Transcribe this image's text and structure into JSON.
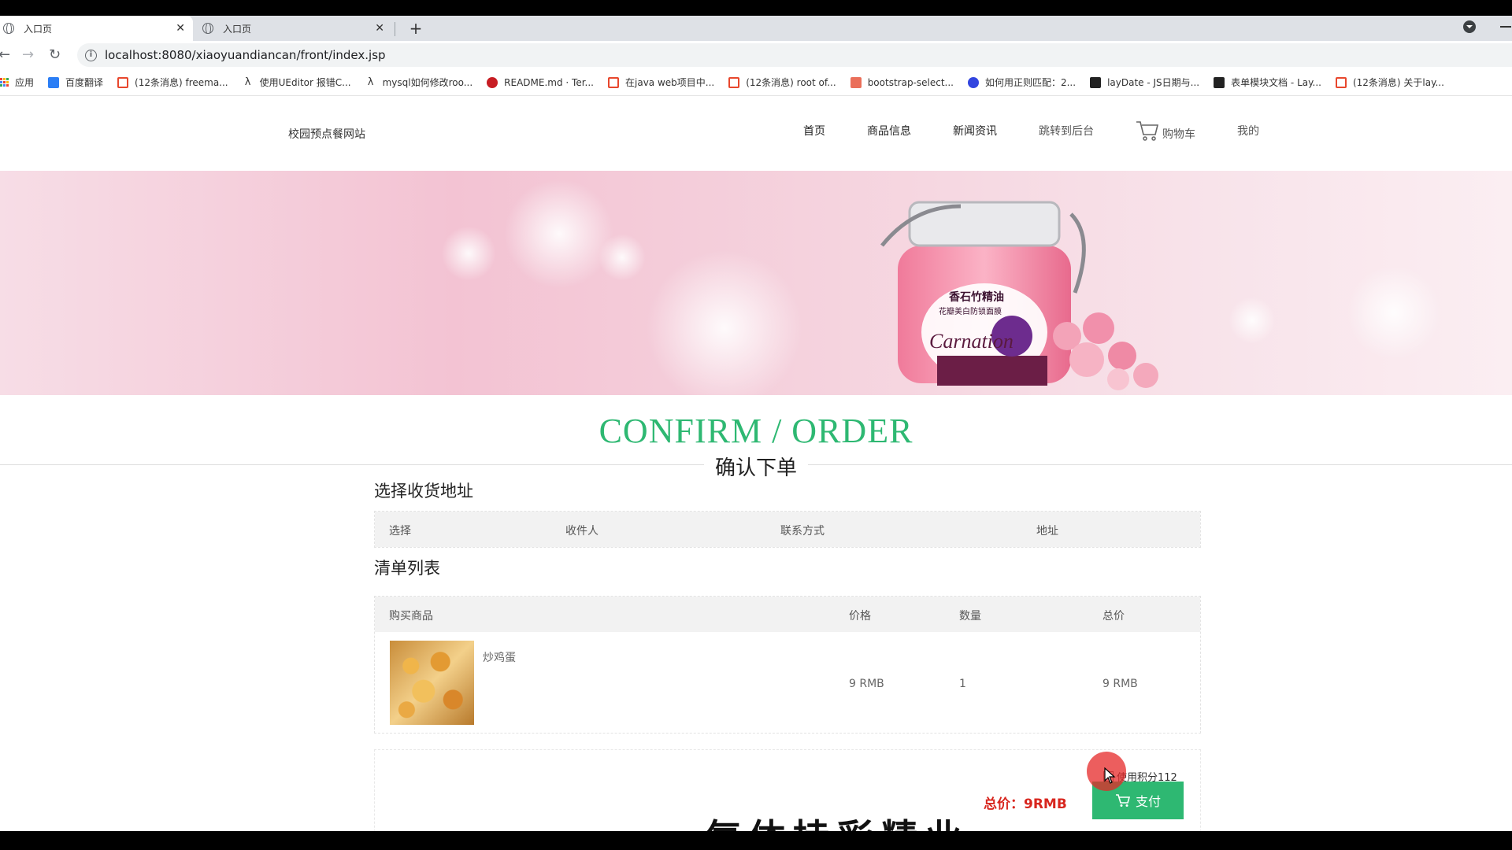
{
  "browser": {
    "tabs": [
      {
        "title": "入口页",
        "active": true
      },
      {
        "title": "入口页",
        "active": false
      }
    ],
    "url": "localhost:8080/xiaoyuandiancan/front/index.jsp",
    "bookmarks": [
      {
        "label": "应用",
        "icon": "apps-grid-icon"
      },
      {
        "label": "百度翻译",
        "icon": "baidu-translate-icon",
        "color": "#2b7ef5"
      },
      {
        "label": "(12条消息) freema...",
        "icon": "csdn-icon",
        "color": "#e8472d"
      },
      {
        "label": "使用UEditor 报错C...",
        "icon": "lambda-icon",
        "color": "#444444"
      },
      {
        "label": "mysql如何修改roo...",
        "icon": "lambda-icon",
        "color": "#444444"
      },
      {
        "label": "README.md · Ter...",
        "icon": "gitee-icon",
        "color": "#c71d23"
      },
      {
        "label": "在java web项目中...",
        "icon": "csdn-icon",
        "color": "#e8472d"
      },
      {
        "label": "(12条消息) root of...",
        "icon": "csdn-icon",
        "color": "#e8472d"
      },
      {
        "label": "bootstrap-select...",
        "icon": "jianshu-icon",
        "color": "#ea6f5a"
      },
      {
        "label": "如何用正则匹配：2...",
        "icon": "baidu-paw-icon",
        "color": "#3245df"
      },
      {
        "label": "layDate - JS日期与...",
        "icon": "layui-icon",
        "color": "#222222"
      },
      {
        "label": "表单模块文档 - Lay...",
        "icon": "layui-icon",
        "color": "#222222"
      },
      {
        "label": "(12条消息) 关于lay...",
        "icon": "csdn-icon",
        "color": "#e8472d"
      }
    ]
  },
  "site": {
    "logo": "校园预点餐网站",
    "nav": {
      "home": "首页",
      "products": "商品信息",
      "news": "新闻资讯",
      "admin": "跳转到后台",
      "cart": "购物车",
      "mine": "我的"
    }
  },
  "banner": {
    "jar_label_line1": "香石竹精油",
    "jar_label_line2": "花瓣美白防锁面膜",
    "jar_script": "Carnation"
  },
  "confirm": {
    "title": "CONFIRM / ORDER",
    "subtitle": "确认下单"
  },
  "address": {
    "section_title": "选择收货地址",
    "headers": [
      "选择",
      "收件人",
      "联系方式",
      "地址"
    ]
  },
  "order": {
    "section_title": "清单列表",
    "headers": [
      "购买商品",
      "价格",
      "数量",
      "总价"
    ],
    "rows": [
      {
        "name": "炒鸡蛋",
        "price": "9 RMB",
        "qty": "1",
        "total": "9 RMB"
      }
    ]
  },
  "footer": {
    "points_label": "使用积分112",
    "total_label": "总价：9RMB",
    "pay_label": "支付",
    "faded_heading": "气体持彩精业"
  },
  "colors": {
    "accent_green": "#2eb872",
    "total_red": "#d8261e"
  }
}
